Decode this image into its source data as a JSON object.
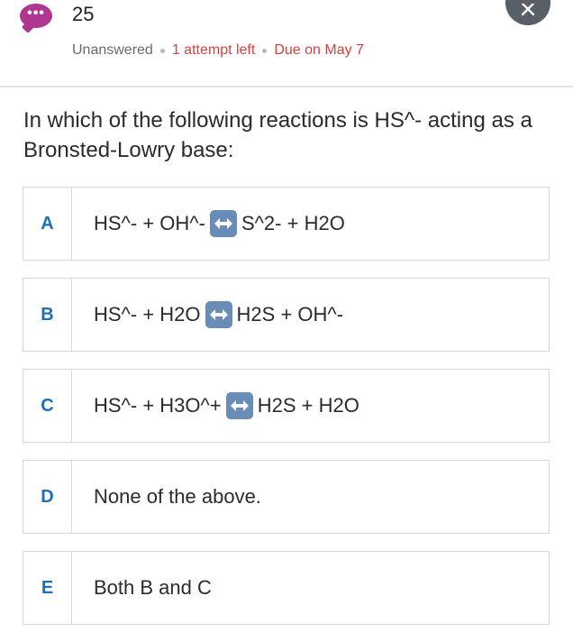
{
  "header": {
    "chat_icon_glyph": "•••",
    "question_number": "25",
    "status": "Unanswered",
    "attempts": "1 attempt left",
    "due": "Due on May 7"
  },
  "question": {
    "text": "In which of the following reactions is HS^- acting as a Bronsted-Lowry base:"
  },
  "options": [
    {
      "letter": "A",
      "left": "HS^- + OH^-",
      "right": "S^2- + H2O"
    },
    {
      "letter": "B",
      "left": "HS^- + H2O",
      "right": "H2S + OH^-"
    },
    {
      "letter": "C",
      "left": "HS^- + H3O^+",
      "right": "H2S + H2O"
    },
    {
      "letter": "D",
      "text": "None of the above."
    },
    {
      "letter": "E",
      "text": "Both B and C"
    }
  ],
  "colors": {
    "accent_letter": "#1f6fb5",
    "status_red": "#d0433f",
    "chat_bubble": "#b0378f",
    "close_button": "#585f66",
    "arrow_icon": "#6a8db8"
  },
  "icons": {
    "chat": "chat-bubble-icon",
    "close": "close-icon",
    "equilibrium": "left-right-arrow-icon"
  }
}
